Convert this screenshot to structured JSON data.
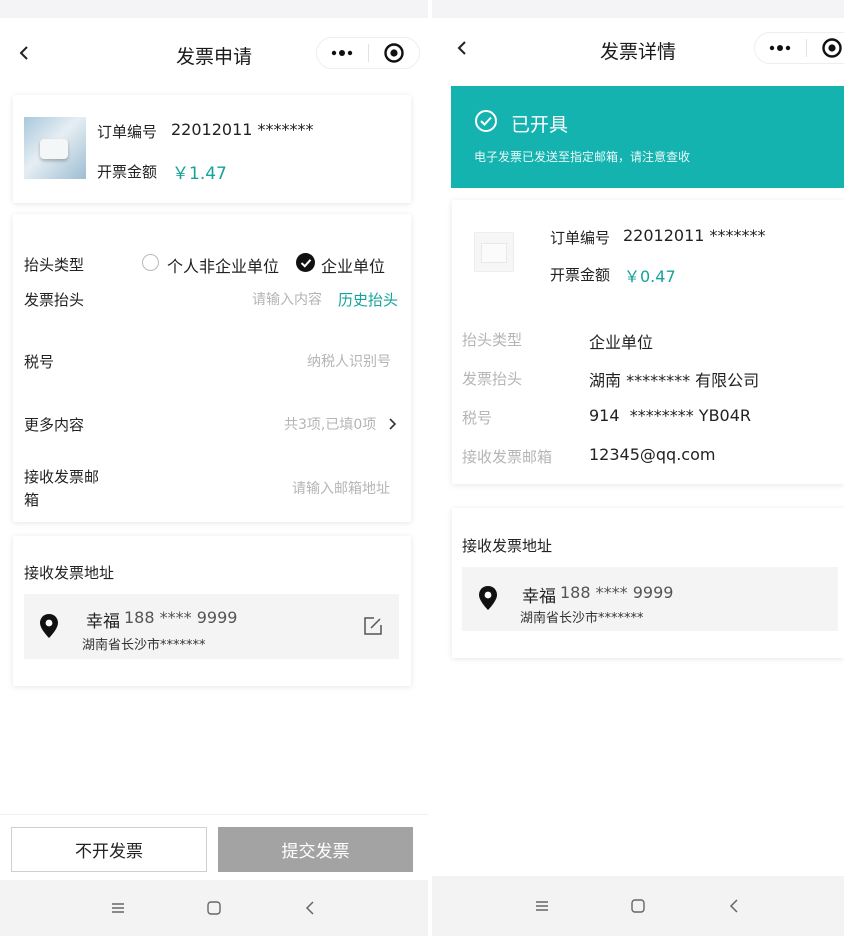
{
  "left": {
    "nav": {
      "title": "发票申请"
    },
    "order": {
      "number_label": "订单编号",
      "number_value": "22012011 *******",
      "amount_label": "开票金额",
      "amount_value": "￥1.47"
    },
    "form": {
      "header_type_label": "抬头类型",
      "option_personal": "个人非企业单位",
      "option_company": "企业单位",
      "selected_option": "企业单位",
      "invoice_header_label": "发票抬头",
      "invoice_header_placeholder": "请输入内容",
      "history_link": "历史抬头",
      "tax_label": "税号",
      "tax_placeholder": "纳税人识别号",
      "more_label": "更多内容",
      "more_value": "共3项,已填0项",
      "email_label_line1": "接收发票邮",
      "email_label_line2": "箱",
      "email_placeholder": "请输入邮箱地址"
    },
    "address": {
      "section_label": "接收发票地址",
      "name": "幸福",
      "phone": "188 **** 9999",
      "detail": "湖南省长沙市*******"
    },
    "buttons": {
      "no_invoice": "不开发票",
      "submit": "提交发票"
    }
  },
  "right": {
    "nav": {
      "title": "发票详情"
    },
    "banner": {
      "status": "已开具",
      "message": "电子发票已发送至指定邮箱，请注意查收",
      "color": "#14b3b0"
    },
    "order": {
      "number_label": "订单编号",
      "number_value": "22012011 *******",
      "amount_label": "开票金额",
      "amount_value": "￥0.47"
    },
    "details": [
      {
        "label": "抬头类型",
        "value": "企业单位"
      },
      {
        "label": "发票抬头",
        "value": "湖南 ******** 有限公司"
      },
      {
        "label": "税号",
        "value": "914  ******** YB04R"
      },
      {
        "label": "接收发票邮箱",
        "value": "12345@qq.com"
      }
    ],
    "address": {
      "section_label": "接收发票地址",
      "name": "幸福",
      "phone": "188 **** 9999",
      "detail": "湖南省长沙市*******"
    }
  },
  "colors": {
    "accent": "#14a39a",
    "banner": "#14b3b0",
    "submit_bg": "#a3a3a3",
    "address_bg": "#f4f4f4"
  },
  "icons": [
    "back-arrow-icon",
    "more-dots-icon",
    "target-close-icon",
    "check-circle-icon",
    "location-pin-icon",
    "edit-icon",
    "chevron-right-icon",
    "menu-icon",
    "home-square-icon",
    "back-chevron-icon"
  ]
}
